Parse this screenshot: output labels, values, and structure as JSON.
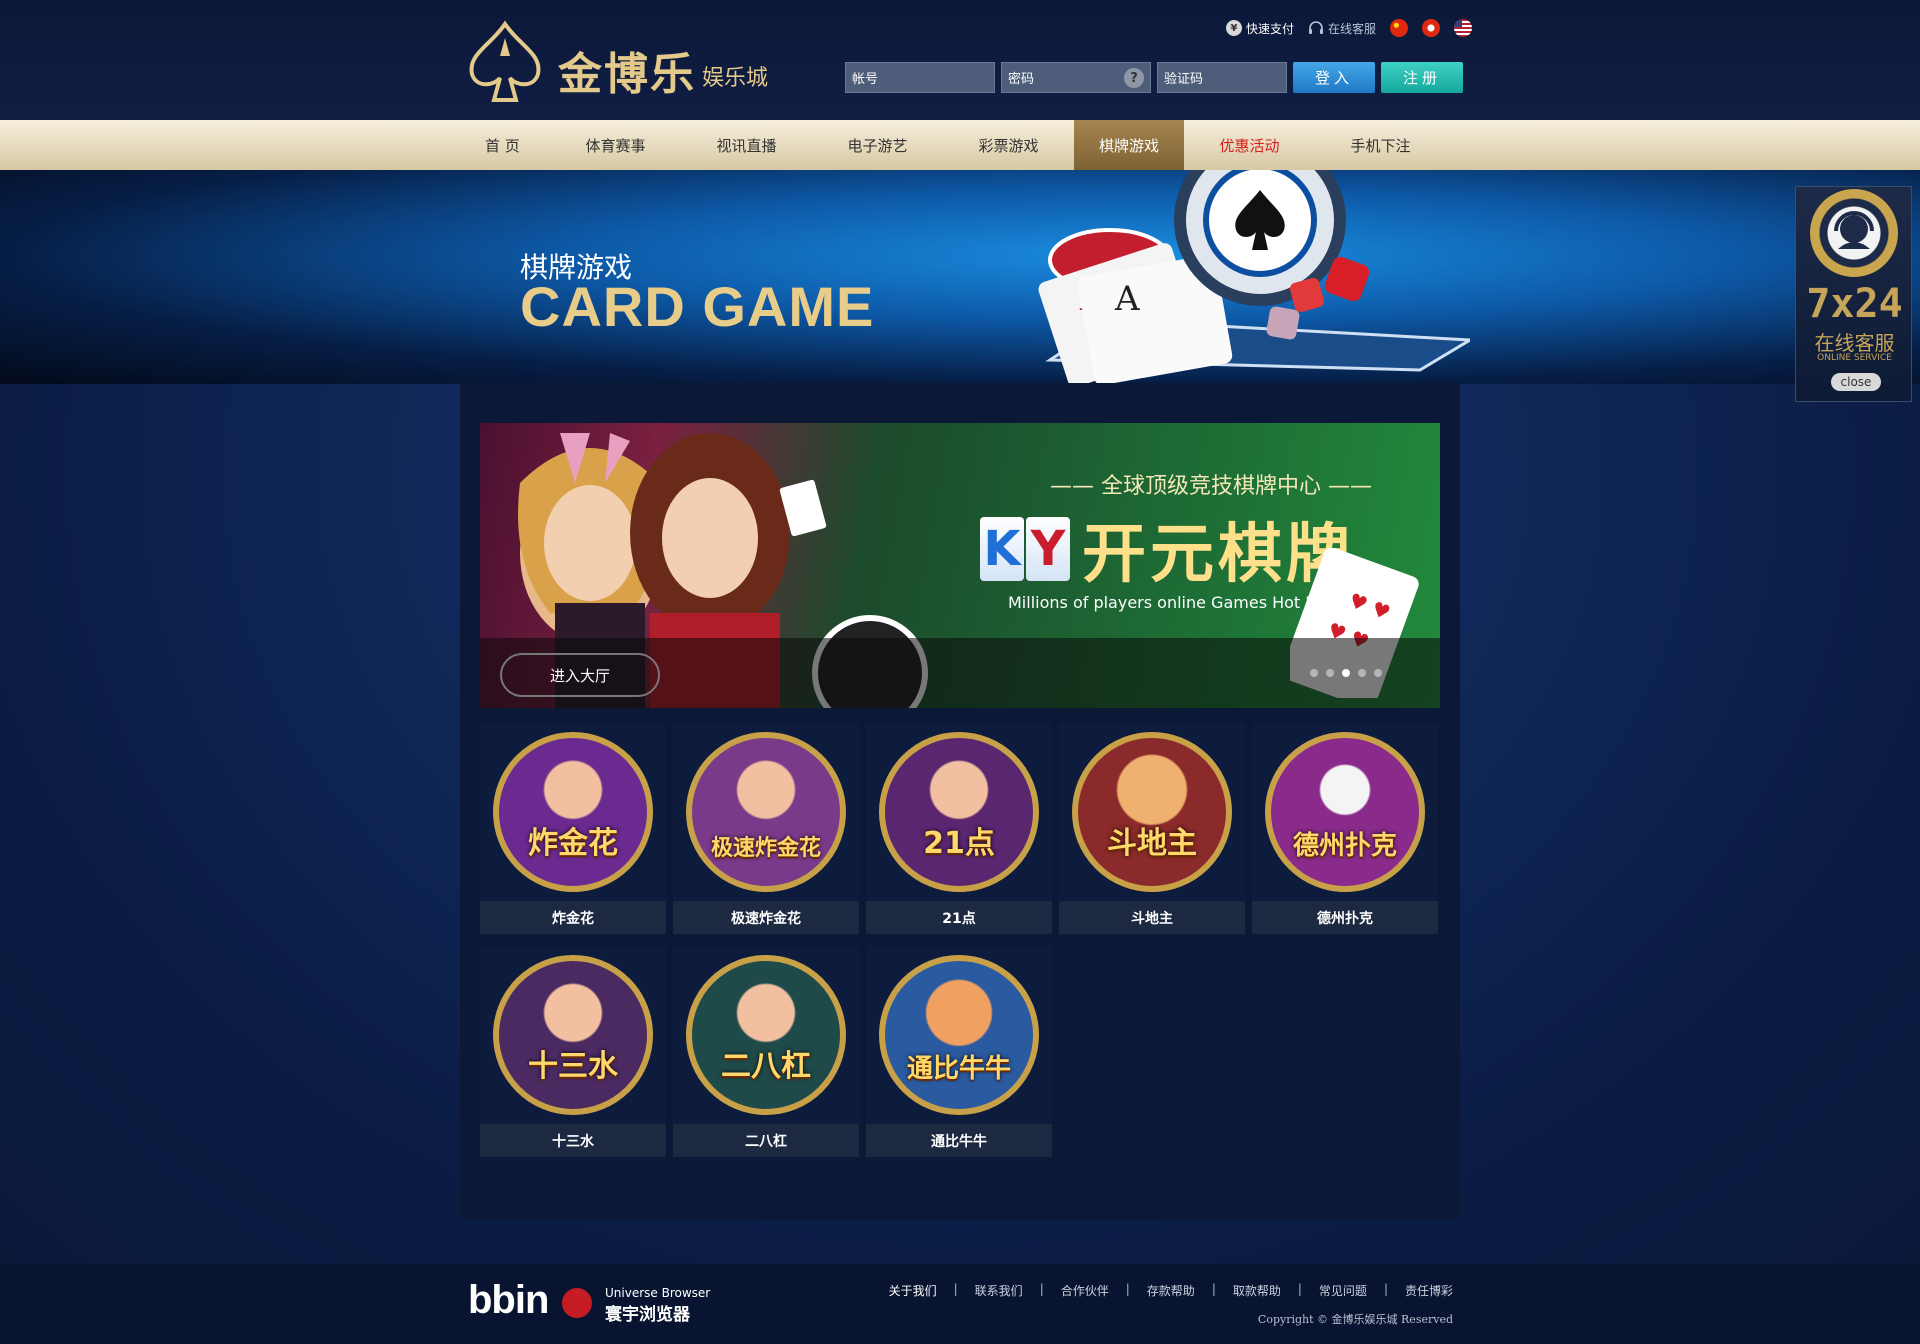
{
  "header": {
    "logo_main": "金博乐",
    "logo_sub": "娱乐城",
    "toplinks": {
      "fast_pay": "快速支付",
      "customer_service": "在线客服"
    },
    "login": {
      "account_placeholder": "帐号",
      "password_placeholder": "密码",
      "captcha_placeholder": "验证码",
      "help_symbol": "?",
      "login_button": "登入",
      "register_button": "注册"
    }
  },
  "nav": {
    "items": [
      {
        "label": "首 页"
      },
      {
        "label": "体育赛事"
      },
      {
        "label": "视讯直播"
      },
      {
        "label": "电子游艺"
      },
      {
        "label": "彩票游戏"
      },
      {
        "label": "棋牌游戏",
        "active": true
      },
      {
        "label": "优惠活动",
        "highlight": true
      },
      {
        "label": "手机下注"
      }
    ]
  },
  "banner": {
    "title_cn": "棋牌游戏",
    "title_en": "CARD GAME"
  },
  "promo": {
    "tagline": "—— 全球顶级竞技棋牌中心 ——",
    "brand_letters": [
      "K",
      "Y"
    ],
    "brand_name": "开元棋牌",
    "subtitle": "Millions of players online Games Hot PK",
    "enter_button": "进入大厅",
    "slides": 5,
    "current_slide": 3
  },
  "games": [
    {
      "name": "炸金花",
      "art": "炸金花",
      "color": "#6b2a8f"
    },
    {
      "name": "极速炸金花",
      "art": "极速炸金花",
      "color": "#7a3a8a"
    },
    {
      "name": "21点",
      "art": "21点",
      "color": "#5a2670"
    },
    {
      "name": "斗地主",
      "art": "斗地主",
      "color": "#8a2a2a"
    },
    {
      "name": "德州扑克",
      "art": "德州扑克",
      "color": "#8a2a8a"
    },
    {
      "name": "十三水",
      "art": "十三水",
      "color": "#4a2a60"
    },
    {
      "name": "二八杠",
      "art": "二八杠",
      "color": "#1f4a4a"
    },
    {
      "name": "通比牛牛",
      "art": "通比牛牛",
      "color": "#2a5aa0"
    }
  ],
  "service_widget": {
    "hours": "7x24",
    "label_cn": "在线客服",
    "label_en": "ONLINE SERVICE",
    "close": "close"
  },
  "footer": {
    "bbin": "bbin",
    "browser_en": "Universe Browser",
    "browser_cn": "寰宇浏览器",
    "links": [
      "关于我们",
      "联系我们",
      "合作伙伴",
      "存款帮助",
      "取款帮助",
      "常见问题",
      "责任博彩"
    ],
    "copyright": "Copyright ©  金博乐娱乐城  Reserved"
  }
}
